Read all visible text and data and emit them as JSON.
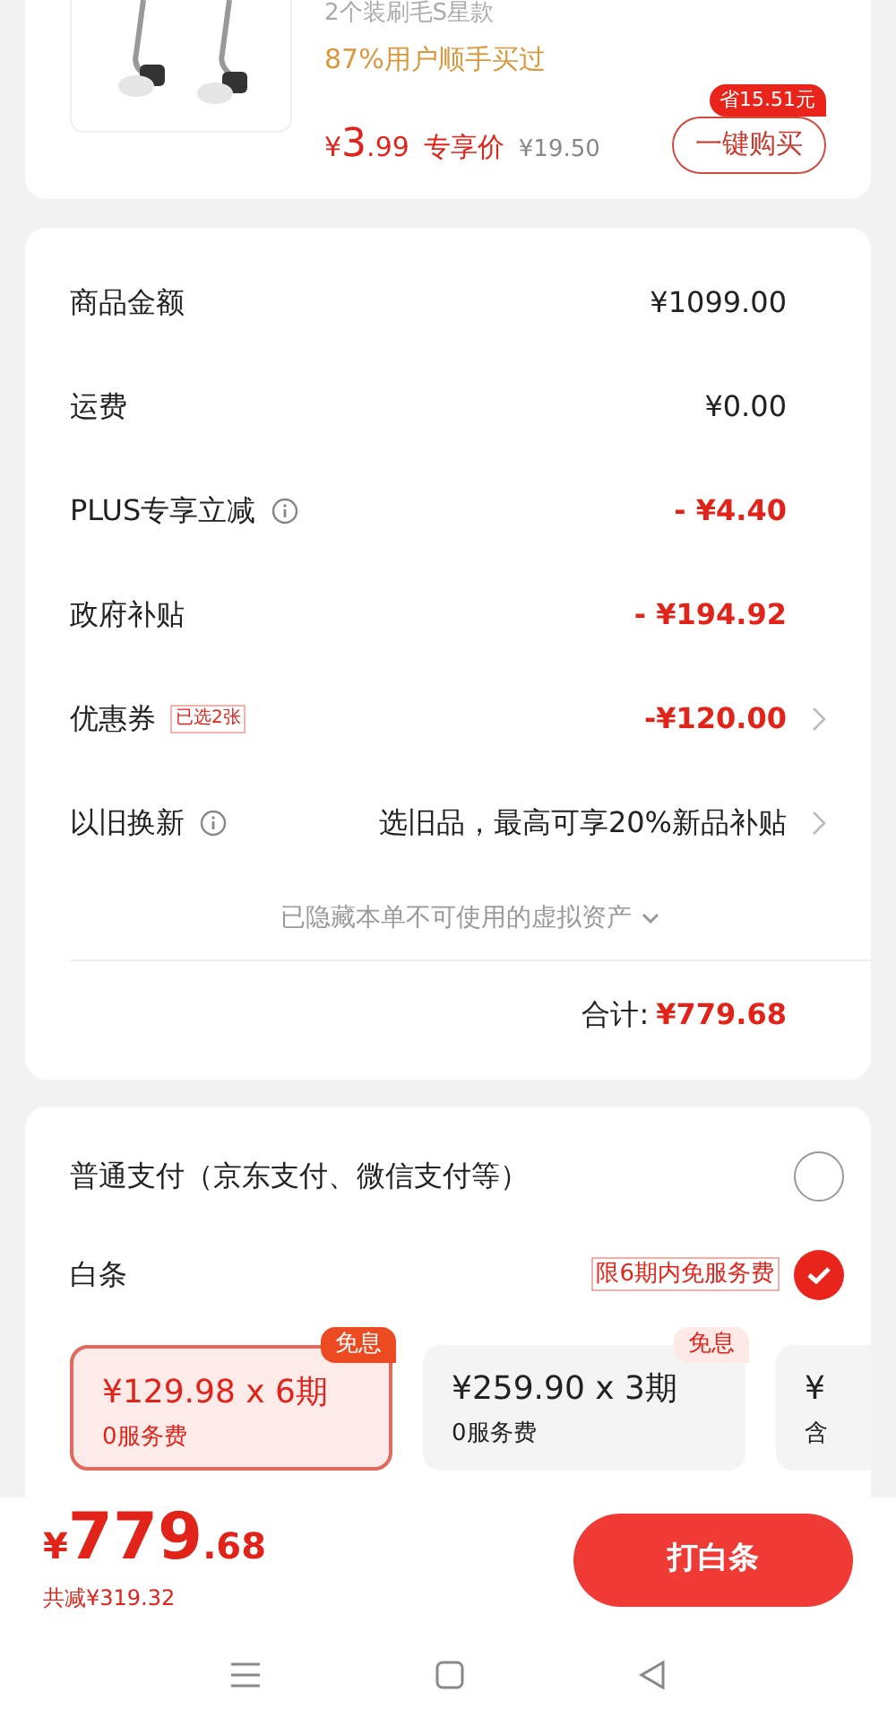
{
  "product": {
    "subtitle": "2个装刷毛S星款",
    "buy_rate": "87%用户顺手买过",
    "price_symbol": "¥",
    "price_int": "3",
    "price_dec": ".99",
    "price_label": "专享价",
    "original_price": "¥19.50",
    "save_badge": "省15.51元",
    "buy_button": "一键购买"
  },
  "summary": {
    "rows": [
      {
        "label": "商品金额",
        "value": "¥1099.00",
        "kind": "amount",
        "info": false,
        "arrow": false
      },
      {
        "label": "运费",
        "value": "¥0.00",
        "kind": "amount",
        "info": false,
        "arrow": false
      },
      {
        "label": "PLUS专享立减",
        "value": "- ¥4.40",
        "kind": "discount",
        "info": true,
        "arrow": false
      },
      {
        "label": "政府补贴",
        "value": "- ¥194.92",
        "kind": "discount",
        "info": false,
        "arrow": false
      },
      {
        "label": "优惠券",
        "badge": "已选2张",
        "value": "-¥120.00",
        "kind": "discount",
        "info": false,
        "arrow": true
      },
      {
        "label": "以旧换新",
        "value": "选旧品，最高可享20%新品补贴",
        "kind": "amount",
        "info": true,
        "arrow": true
      }
    ],
    "hidden_notice": "已隐藏本单不可使用的虚拟资产",
    "total_label": "合计:",
    "total_value": "¥779.68"
  },
  "payment": {
    "methods": [
      {
        "label": "普通支付（京东支付、微信支付等）",
        "selected": false
      },
      {
        "label": "白条",
        "badge": "限6期内免服务费",
        "selected": true
      }
    ],
    "installments": [
      {
        "amount": "¥129.98 x 6期",
        "fee": "0服务费",
        "tag": "免息",
        "selected": true
      },
      {
        "amount": "¥259.90 x 3期",
        "fee": "0服务费",
        "tag": "免息",
        "selected": false
      },
      {
        "amount": "¥",
        "fee": "含",
        "selected": false
      }
    ]
  },
  "bottom": {
    "symbol": "¥",
    "int": "779",
    "dec": ".68",
    "saved": "共减¥319.32",
    "button": "打白条"
  }
}
